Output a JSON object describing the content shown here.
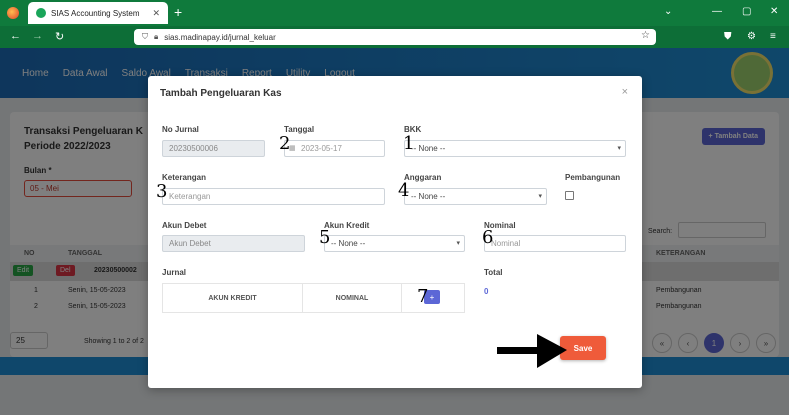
{
  "browser": {
    "tab_title": "SIAS Accounting System",
    "url": "sias.madinapay.id/jurnal_keluar"
  },
  "app": {
    "menu": [
      "Home",
      "Data Awal",
      "Saldo Awal",
      "Transaksi",
      "Report",
      "Utility",
      "Logout"
    ],
    "page_title_line1": "Transaksi Pengeluaran K",
    "page_title_line2": "Periode 2022/2023",
    "bulan_label": "Bulan *",
    "bulan_value": "05 - Mei",
    "tambah_label": "+ Tambah Data",
    "search_label": "Search:",
    "columns": [
      "NO",
      "TANGGAL",
      "KETERANGAN"
    ],
    "selected_row": {
      "edit": "Edit",
      "del": "Del",
      "no": "20230500002"
    },
    "rows": [
      {
        "no": "1",
        "tanggal": "Senin, 15-05-2023",
        "keterangan": "Pembangunan"
      },
      {
        "no": "2",
        "tanggal": "Senin, 15-05-2023",
        "keterangan": "Pembangunan"
      }
    ],
    "page_size": "25",
    "showing": "Showing 1 to 2 of 2",
    "pages": [
      "«",
      "‹",
      "1",
      "›",
      "»"
    ]
  },
  "modal": {
    "title": "Tambah Pengeluaran Kas",
    "close": "×",
    "no_jurnal_label": "No Jurnal",
    "no_jurnal_value": "20230500006",
    "tanggal_label": "Tanggal",
    "tanggal_value": "2023-05-17",
    "bkk_label": "BKK",
    "bkk_value": "-- None --",
    "keterangan_label": "Keterangan",
    "keterangan_placeholder": "Keterangan",
    "anggaran_label": "Anggaran",
    "anggaran_value": "-- None --",
    "pembangunan_label": "Pembangunan",
    "akun_debet_label": "Akun Debet",
    "akun_debet_placeholder": "Akun Debet",
    "akun_kredit_label": "Akun Kredit",
    "akun_kredit_value": "-- None --",
    "nominal_label": "Nominal",
    "nominal_placeholder": "Nominal",
    "jurnal_label": "Jurnal",
    "jurnal_columns": [
      "AKUN KREDIT",
      "NOMINAL"
    ],
    "add_label": "+",
    "total_label": "Total",
    "total_value": "0",
    "save_label": "Save"
  },
  "annotations": [
    "1",
    "2",
    "3",
    "4",
    "5",
    "6",
    "7"
  ]
}
